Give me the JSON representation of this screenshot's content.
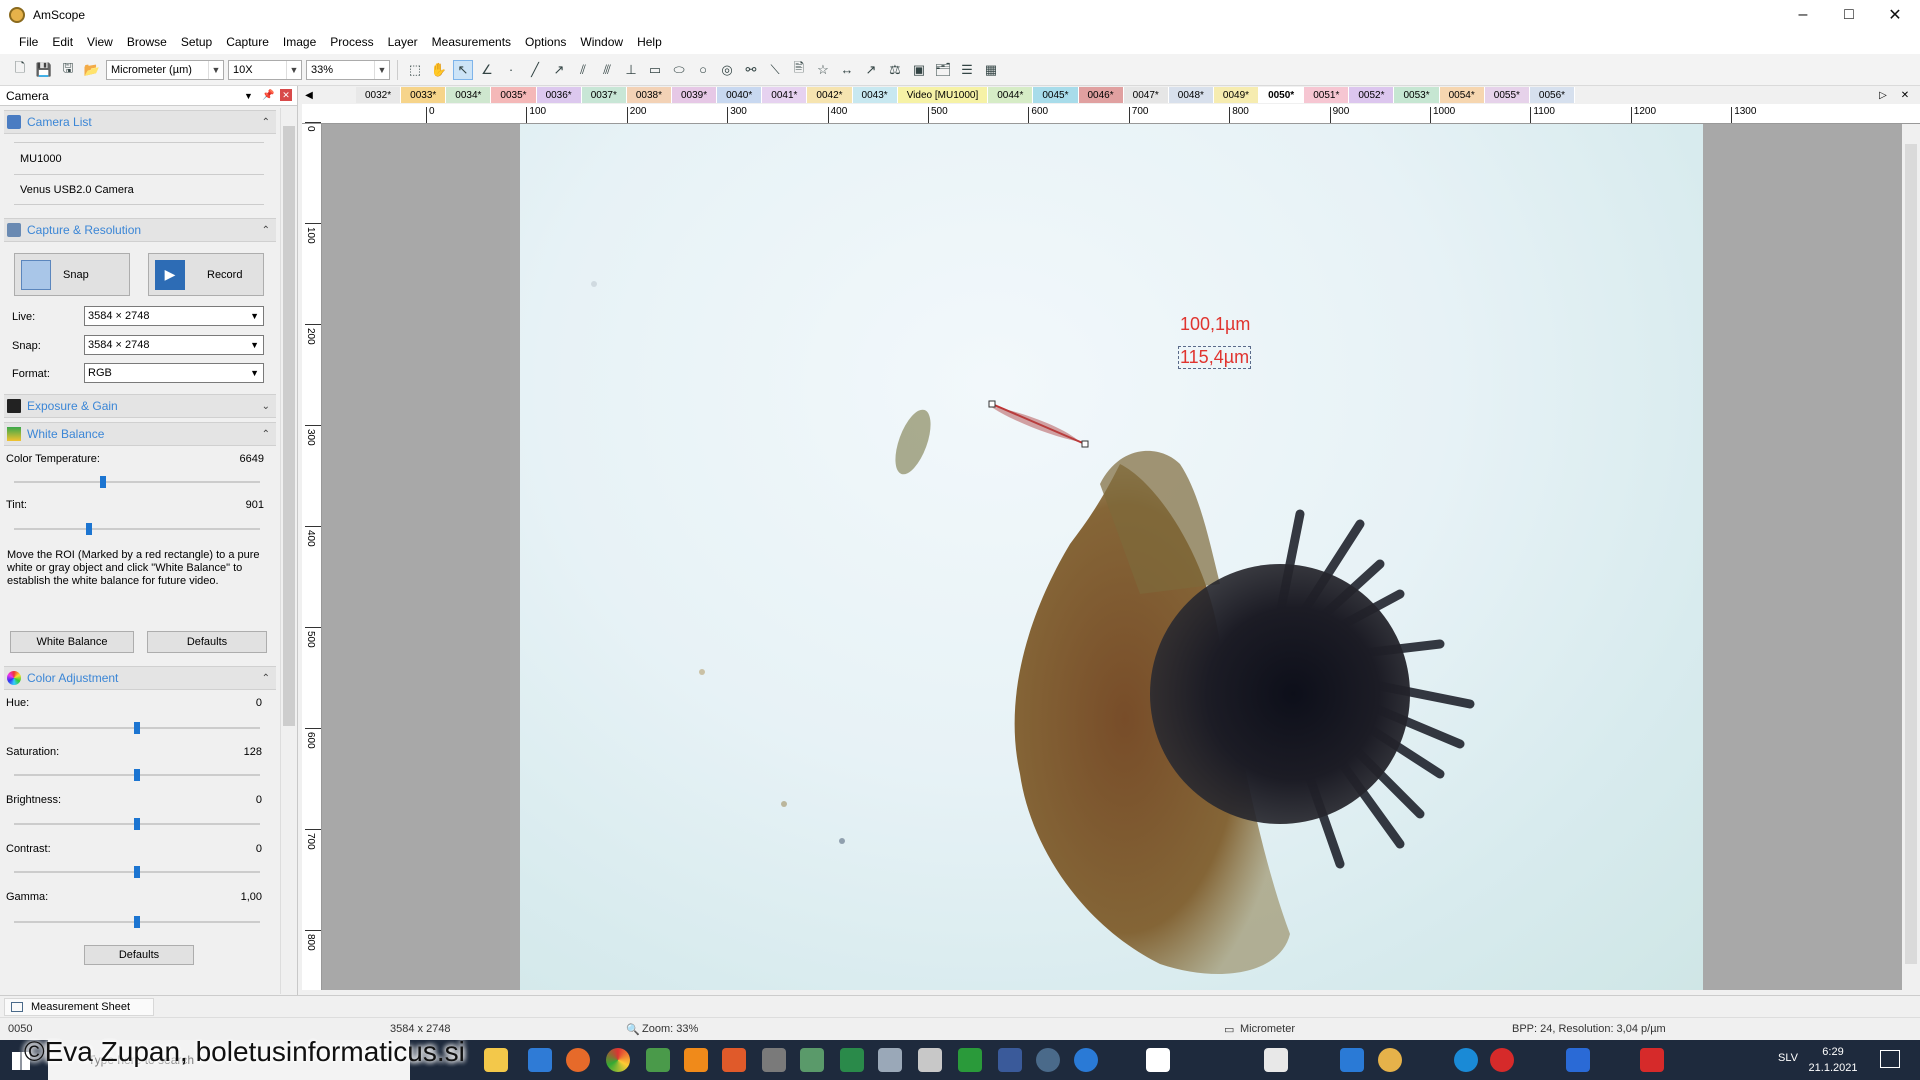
{
  "window": {
    "title": "AmScope"
  },
  "menu": [
    "File",
    "Edit",
    "View",
    "Browse",
    "Setup",
    "Capture",
    "Image",
    "Process",
    "Layer",
    "Measurements",
    "Options",
    "Window",
    "Help"
  ],
  "toolbar": {
    "unit": "Micrometer (µm)",
    "objective": "10X",
    "zoom": "33%"
  },
  "panel": {
    "title": "Camera",
    "camera_list": {
      "title": "Camera List",
      "items": [
        "MU1000",
        "Venus USB2.0 Camera"
      ]
    },
    "capture": {
      "title": "Capture & Resolution",
      "snap_label": "Snap",
      "record_label": "Record",
      "live_label": "Live:",
      "live_value": "3584 × 2748",
      "snap_res_label": "Snap:",
      "snap_res_value": "3584 × 2748",
      "format_label": "Format:",
      "format_value": "RGB"
    },
    "exposure": {
      "title": "Exposure & Gain"
    },
    "white_balance": {
      "title": "White Balance",
      "color_temp_label": "Color Temperature:",
      "color_temp_value": "6649",
      "tint_label": "Tint:",
      "tint_value": "901",
      "hint": "Move the ROI (Marked by a red rectangle) to a pure white or gray object and click \"White Balance\" to establish the white balance for future video.",
      "wb_button": "White Balance",
      "defaults_button": "Defaults"
    },
    "color_adjustment": {
      "title": "Color Adjustment",
      "hue_label": "Hue:",
      "hue_value": "0",
      "saturation_label": "Saturation:",
      "saturation_value": "128",
      "brightness_label": "Brightness:",
      "brightness_value": "0",
      "contrast_label": "Contrast:",
      "contrast_value": "0",
      "gamma_label": "Gamma:",
      "gamma_value": "1,00",
      "defaults_button": "Defaults"
    }
  },
  "tabs": [
    {
      "label": "0032*",
      "color": "#e8e8e8"
    },
    {
      "label": "0033*",
      "color": "#f6d48a"
    },
    {
      "label": "0034*",
      "color": "#cfe7cf"
    },
    {
      "label": "0035*",
      "color": "#f4b8b8"
    },
    {
      "label": "0036*",
      "color": "#dcc8ee"
    },
    {
      "label": "0037*",
      "color": "#c8e6d6"
    },
    {
      "label": "0038*",
      "color": "#f3d2b6"
    },
    {
      "label": "0039*",
      "color": "#e6c8e6"
    },
    {
      "label": "0040*",
      "color": "#c8d8f0"
    },
    {
      "label": "0041*",
      "color": "#e6d2f0"
    },
    {
      "label": "0042*",
      "color": "#f6e4b0"
    },
    {
      "label": "0043*",
      "color": "#c8e8f0"
    },
    {
      "label": "Video [MU1000]",
      "color": "#f6f2a6"
    },
    {
      "label": "0044*",
      "color": "#d6ecc6"
    },
    {
      "label": "0045*",
      "color": "#a8dcea"
    },
    {
      "label": "0046*",
      "color": "#e0a0a0"
    },
    {
      "label": "0047*",
      "color": "#e6e6e6"
    },
    {
      "label": "0048*",
      "color": "#d8e0ec"
    },
    {
      "label": "0049*",
      "color": "#f6ecb0"
    },
    {
      "label": "0050*",
      "color": "#ffffff"
    },
    {
      "label": "0051*",
      "color": "#f6c6d2"
    },
    {
      "label": "0052*",
      "color": "#dcc6ee"
    },
    {
      "label": "0053*",
      "color": "#c6e6d2"
    },
    {
      "label": "0054*",
      "color": "#f6d6b0"
    },
    {
      "label": "0055*",
      "color": "#e6d2ea"
    },
    {
      "label": "0056*",
      "color": "#d6e0ee"
    }
  ],
  "active_tab": "0050*",
  "ruler": {
    "h_labels": [
      "0",
      "100",
      "200",
      "300",
      "400",
      "500",
      "600",
      "700",
      "800",
      "900",
      "1000",
      "1100",
      "1200",
      "1300"
    ],
    "v_labels": [
      "0",
      "100",
      "200",
      "300",
      "400",
      "500",
      "600",
      "700",
      "800"
    ]
  },
  "measurement": {
    "line1": "100,1µm",
    "line2": "115,4µm"
  },
  "measurement_sheet": "Measurement Sheet",
  "status": {
    "name": "0050",
    "size": "3584 x 2748",
    "zoom": "Zoom: 33%",
    "unit": "Micrometer",
    "bpp": "BPP: 24, Resolution: 3,04 p/µm"
  },
  "taskbar": {
    "search_placeholder": "Type here to search",
    "lang": "SLV",
    "time": "6:29",
    "date": "21.1.2021"
  },
  "watermark": "©Eva Zupan, boletusinformaticus.si"
}
